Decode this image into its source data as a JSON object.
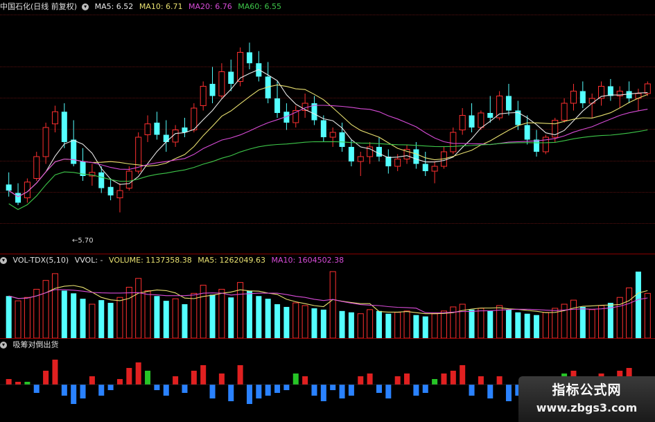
{
  "price_header": {
    "title": "中国石化(日线 前复权)",
    "ma5": "MA5: 6.52",
    "ma10": "MA10: 6.71",
    "ma20": "MA20: 6.76",
    "ma60": "MA60: 6.55"
  },
  "volume_header": {
    "title": "VOL-TDX(5,10)",
    "vvol": "VVOL: -",
    "volume": "VOLUME: 1137358.38",
    "ma5": "MA5: 1262049.63",
    "ma10": "MA10: 1604502.38"
  },
  "indicator_header": {
    "title": "吸筹对倒出货"
  },
  "annotations": {
    "low_price": "5.70"
  },
  "watermark": {
    "line1": "指标公式网",
    "line2": "www.zbgs3.com"
  },
  "colors": {
    "up": "#ff3030",
    "down": "#54ffff",
    "ma5": "#e8e8e8",
    "ma10": "#e8e070",
    "ma20": "#d84cd8",
    "ma60": "#3ec84a",
    "bar_red": "#e02020",
    "bar_blue": "#2a82ff",
    "bar_green": "#26c426"
  },
  "chart_data": {
    "type": "candlestick",
    "price_range_visible": [
      5.5,
      7.3
    ],
    "candles": [
      {
        "o": 5.95,
        "h": 6.05,
        "l": 5.85,
        "c": 5.9
      },
      {
        "o": 5.88,
        "h": 5.96,
        "l": 5.78,
        "c": 5.8
      },
      {
        "o": 5.84,
        "h": 6.0,
        "l": 5.8,
        "c": 5.97
      },
      {
        "o": 6.0,
        "h": 6.22,
        "l": 5.98,
        "c": 6.18
      },
      {
        "o": 6.18,
        "h": 6.46,
        "l": 6.12,
        "c": 6.42
      },
      {
        "o": 6.45,
        "h": 6.6,
        "l": 6.38,
        "c": 6.55
      },
      {
        "o": 6.55,
        "h": 6.62,
        "l": 6.25,
        "c": 6.3
      },
      {
        "o": 6.32,
        "h": 6.48,
        "l": 6.1,
        "c": 6.12
      },
      {
        "o": 6.14,
        "h": 6.25,
        "l": 5.98,
        "c": 6.02
      },
      {
        "o": 6.02,
        "h": 6.12,
        "l": 5.94,
        "c": 6.05
      },
      {
        "o": 6.05,
        "h": 6.1,
        "l": 5.88,
        "c": 5.92
      },
      {
        "o": 5.93,
        "h": 6.0,
        "l": 5.82,
        "c": 5.86
      },
      {
        "o": 5.84,
        "h": 5.96,
        "l": 5.72,
        "c": 5.9
      },
      {
        "o": 5.92,
        "h": 6.1,
        "l": 5.9,
        "c": 6.06
      },
      {
        "o": 6.06,
        "h": 6.38,
        "l": 6.04,
        "c": 6.34
      },
      {
        "o": 6.36,
        "h": 6.52,
        "l": 6.3,
        "c": 6.45
      },
      {
        "o": 6.46,
        "h": 6.55,
        "l": 6.32,
        "c": 6.36
      },
      {
        "o": 6.36,
        "h": 6.48,
        "l": 6.22,
        "c": 6.3
      },
      {
        "o": 6.3,
        "h": 6.44,
        "l": 6.26,
        "c": 6.4
      },
      {
        "o": 6.42,
        "h": 6.5,
        "l": 6.34,
        "c": 6.38
      },
      {
        "o": 6.4,
        "h": 6.62,
        "l": 6.38,
        "c": 6.58
      },
      {
        "o": 6.6,
        "h": 6.8,
        "l": 6.56,
        "c": 6.76
      },
      {
        "o": 6.78,
        "h": 6.92,
        "l": 6.62,
        "c": 6.68
      },
      {
        "o": 6.68,
        "h": 6.95,
        "l": 6.66,
        "c": 6.88
      },
      {
        "o": 6.88,
        "h": 6.98,
        "l": 6.72,
        "c": 6.78
      },
      {
        "o": 6.8,
        "h": 7.08,
        "l": 6.76,
        "c": 7.04
      },
      {
        "o": 7.04,
        "h": 7.12,
        "l": 6.9,
        "c": 6.95
      },
      {
        "o": 6.95,
        "h": 7.05,
        "l": 6.8,
        "c": 6.84
      },
      {
        "o": 6.84,
        "h": 6.96,
        "l": 6.62,
        "c": 6.66
      },
      {
        "o": 6.66,
        "h": 6.8,
        "l": 6.5,
        "c": 6.54
      },
      {
        "o": 6.55,
        "h": 6.62,
        "l": 6.4,
        "c": 6.46
      },
      {
        "o": 6.46,
        "h": 6.6,
        "l": 6.42,
        "c": 6.56
      },
      {
        "o": 6.56,
        "h": 6.7,
        "l": 6.5,
        "c": 6.62
      },
      {
        "o": 6.62,
        "h": 6.68,
        "l": 6.44,
        "c": 6.48
      },
      {
        "o": 6.48,
        "h": 6.52,
        "l": 6.3,
        "c": 6.34
      },
      {
        "o": 6.34,
        "h": 6.42,
        "l": 6.26,
        "c": 6.38
      },
      {
        "o": 6.38,
        "h": 6.46,
        "l": 6.22,
        "c": 6.26
      },
      {
        "o": 6.26,
        "h": 6.32,
        "l": 6.1,
        "c": 6.14
      },
      {
        "o": 6.14,
        "h": 6.22,
        "l": 6.02,
        "c": 6.18
      },
      {
        "o": 6.18,
        "h": 6.3,
        "l": 6.12,
        "c": 6.26
      },
      {
        "o": 6.26,
        "h": 6.34,
        "l": 6.14,
        "c": 6.18
      },
      {
        "o": 6.18,
        "h": 6.24,
        "l": 6.04,
        "c": 6.1
      },
      {
        "o": 6.1,
        "h": 6.2,
        "l": 6.06,
        "c": 6.16
      },
      {
        "o": 6.16,
        "h": 6.28,
        "l": 6.12,
        "c": 6.24
      },
      {
        "o": 6.24,
        "h": 6.3,
        "l": 6.08,
        "c": 6.12
      },
      {
        "o": 6.12,
        "h": 6.22,
        "l": 6.02,
        "c": 6.06
      },
      {
        "o": 6.06,
        "h": 6.14,
        "l": 5.96,
        "c": 6.1
      },
      {
        "o": 6.1,
        "h": 6.26,
        "l": 6.08,
        "c": 6.22
      },
      {
        "o": 6.22,
        "h": 6.42,
        "l": 6.2,
        "c": 6.38
      },
      {
        "o": 6.4,
        "h": 6.58,
        "l": 6.36,
        "c": 6.52
      },
      {
        "o": 6.52,
        "h": 6.62,
        "l": 6.38,
        "c": 6.42
      },
      {
        "o": 6.42,
        "h": 6.56,
        "l": 6.4,
        "c": 6.54
      },
      {
        "o": 6.54,
        "h": 6.68,
        "l": 6.46,
        "c": 6.5
      },
      {
        "o": 6.5,
        "h": 6.72,
        "l": 6.48,
        "c": 6.68
      },
      {
        "o": 6.68,
        "h": 6.78,
        "l": 6.52,
        "c": 6.56
      },
      {
        "o": 6.56,
        "h": 6.64,
        "l": 6.4,
        "c": 6.44
      },
      {
        "o": 6.44,
        "h": 6.52,
        "l": 6.28,
        "c": 6.32
      },
      {
        "o": 6.32,
        "h": 6.4,
        "l": 6.18,
        "c": 6.22
      },
      {
        "o": 6.22,
        "h": 6.36,
        "l": 6.2,
        "c": 6.34
      },
      {
        "o": 6.34,
        "h": 6.5,
        "l": 6.3,
        "c": 6.48
      },
      {
        "o": 6.48,
        "h": 6.66,
        "l": 6.46,
        "c": 6.62
      },
      {
        "o": 6.62,
        "h": 6.78,
        "l": 6.56,
        "c": 6.72
      },
      {
        "o": 6.72,
        "h": 6.8,
        "l": 6.58,
        "c": 6.62
      },
      {
        "o": 6.62,
        "h": 6.7,
        "l": 6.5,
        "c": 6.66
      },
      {
        "o": 6.66,
        "h": 6.8,
        "l": 6.6,
        "c": 6.76
      },
      {
        "o": 6.76,
        "h": 6.82,
        "l": 6.64,
        "c": 6.68
      },
      {
        "o": 6.68,
        "h": 6.76,
        "l": 6.58,
        "c": 6.72
      },
      {
        "o": 6.72,
        "h": 6.8,
        "l": 6.62,
        "c": 6.66
      },
      {
        "o": 6.66,
        "h": 6.74,
        "l": 6.56,
        "c": 6.7
      },
      {
        "o": 6.7,
        "h": 6.8,
        "l": 6.68,
        "c": 6.78
      }
    ],
    "volume_bars": [
      {
        "v": 0.62,
        "up": false
      },
      {
        "v": 0.55,
        "up": true
      },
      {
        "v": 0.6,
        "up": true
      },
      {
        "v": 0.72,
        "up": true
      },
      {
        "v": 0.85,
        "up": true
      },
      {
        "v": 0.95,
        "up": true
      },
      {
        "v": 0.7,
        "up": false
      },
      {
        "v": 0.66,
        "up": false
      },
      {
        "v": 0.58,
        "up": false
      },
      {
        "v": 0.5,
        "up": true
      },
      {
        "v": 0.56,
        "up": false
      },
      {
        "v": 0.52,
        "up": false
      },
      {
        "v": 0.6,
        "up": true
      },
      {
        "v": 0.75,
        "up": true
      },
      {
        "v": 0.88,
        "up": true
      },
      {
        "v": 0.7,
        "up": true
      },
      {
        "v": 0.62,
        "up": false
      },
      {
        "v": 0.55,
        "up": false
      },
      {
        "v": 0.58,
        "up": true
      },
      {
        "v": 0.5,
        "up": false
      },
      {
        "v": 0.66,
        "up": true
      },
      {
        "v": 0.78,
        "up": true
      },
      {
        "v": 0.64,
        "up": false
      },
      {
        "v": 0.72,
        "up": true
      },
      {
        "v": 0.6,
        "up": false
      },
      {
        "v": 0.82,
        "up": true
      },
      {
        "v": 0.7,
        "up": false
      },
      {
        "v": 0.62,
        "up": false
      },
      {
        "v": 0.58,
        "up": false
      },
      {
        "v": 0.5,
        "up": false
      },
      {
        "v": 0.46,
        "up": false
      },
      {
        "v": 0.52,
        "up": true
      },
      {
        "v": 0.48,
        "up": true
      },
      {
        "v": 0.44,
        "up": false
      },
      {
        "v": 0.42,
        "up": false
      },
      {
        "v": 0.98,
        "up": true
      },
      {
        "v": 0.4,
        "up": false
      },
      {
        "v": 0.38,
        "up": false
      },
      {
        "v": 0.36,
        "up": true
      },
      {
        "v": 0.42,
        "up": true
      },
      {
        "v": 0.4,
        "up": false
      },
      {
        "v": 0.36,
        "up": false
      },
      {
        "v": 0.38,
        "up": true
      },
      {
        "v": 0.4,
        "up": true
      },
      {
        "v": 0.34,
        "up": false
      },
      {
        "v": 0.32,
        "up": false
      },
      {
        "v": 0.36,
        "up": true
      },
      {
        "v": 0.4,
        "up": true
      },
      {
        "v": 0.46,
        "up": true
      },
      {
        "v": 0.5,
        "up": true
      },
      {
        "v": 0.42,
        "up": false
      },
      {
        "v": 0.44,
        "up": true
      },
      {
        "v": 0.4,
        "up": false
      },
      {
        "v": 0.48,
        "up": true
      },
      {
        "v": 0.42,
        "up": false
      },
      {
        "v": 0.38,
        "up": false
      },
      {
        "v": 0.36,
        "up": false
      },
      {
        "v": 0.34,
        "up": false
      },
      {
        "v": 0.38,
        "up": true
      },
      {
        "v": 0.44,
        "up": true
      },
      {
        "v": 0.5,
        "up": true
      },
      {
        "v": 0.56,
        "up": true
      },
      {
        "v": 0.46,
        "up": false
      },
      {
        "v": 0.42,
        "up": true
      },
      {
        "v": 0.48,
        "up": true
      },
      {
        "v": 0.52,
        "up": false
      },
      {
        "v": 0.6,
        "up": true
      },
      {
        "v": 0.74,
        "up": true
      },
      {
        "v": 0.98,
        "up": false
      },
      {
        "v": 0.66,
        "up": true
      }
    ],
    "indicator_bars": [
      0.2,
      0.1,
      0.1,
      -0.3,
      0.5,
      0.9,
      -0.4,
      -0.7,
      -0.5,
      0.3,
      -0.4,
      -0.2,
      0.2,
      0.6,
      0.8,
      0.5,
      -0.2,
      -0.4,
      0.3,
      -0.3,
      0.5,
      0.7,
      -0.5,
      0.4,
      -0.6,
      0.7,
      -0.7,
      -0.5,
      -0.4,
      -0.3,
      -0.2,
      0.4,
      0.3,
      -0.4,
      -0.6,
      -0.2,
      -0.5,
      -0.4,
      0.3,
      0.4,
      -0.3,
      -0.5,
      0.3,
      0.4,
      -0.4,
      -0.3,
      0.2,
      0.4,
      0.5,
      0.7,
      -0.4,
      0.3,
      -0.5,
      0.3,
      -0.6,
      -0.4,
      -0.3,
      -0.5,
      0.2,
      0.3,
      0.4,
      0.5,
      -0.4,
      0.3,
      0.4,
      -0.4,
      0.5,
      0.6,
      -0.5,
      0.3
    ],
    "indicator_green_indices": [
      2,
      15,
      19,
      31,
      45,
      46,
      55,
      60
    ]
  }
}
